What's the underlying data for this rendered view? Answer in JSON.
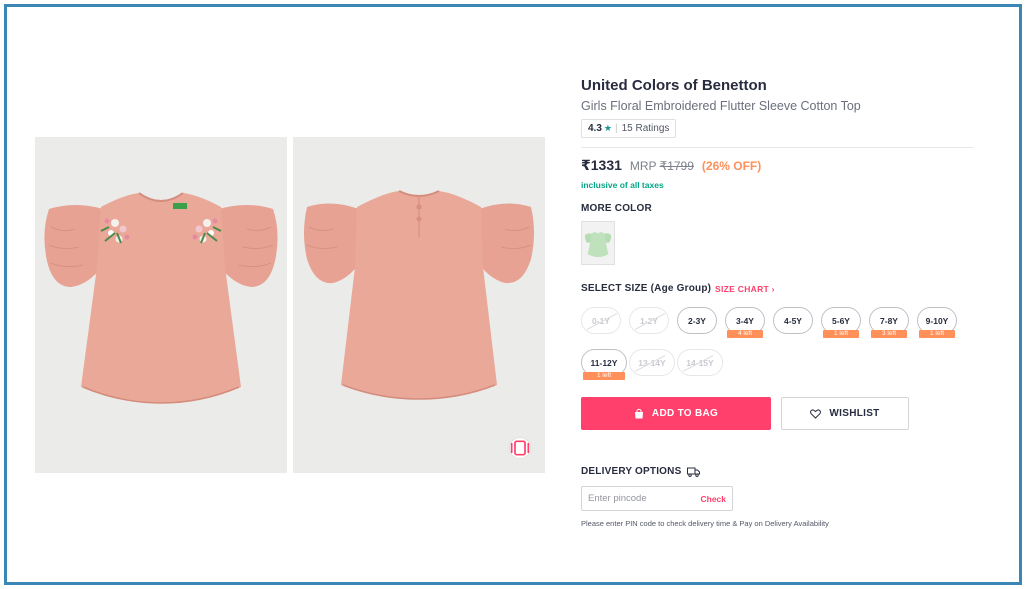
{
  "product": {
    "brand": "United Colors of Benetton",
    "name": "Girls Floral Embroidered Flutter Sleeve Cotton Top",
    "rating": "4.3",
    "rating_count": "15 Ratings",
    "price": "₹1331",
    "mrp_label": "MRP",
    "mrp": "₹1799",
    "discount": "(26% OFF)",
    "tax_note": "inclusive of all taxes"
  },
  "colors": {
    "title": "MORE COLOR",
    "options": [
      {
        "name": "mint green",
        "color": "#b6dcb4"
      }
    ]
  },
  "sizes": {
    "title": "SELECT SIZE (Age Group)",
    "chart_label": "SIZE CHART ›",
    "options": [
      {
        "label": "0-1Y",
        "available": false,
        "stock": ""
      },
      {
        "label": "1-2Y",
        "available": false,
        "stock": ""
      },
      {
        "label": "2-3Y",
        "available": true,
        "stock": ""
      },
      {
        "label": "3-4Y",
        "available": true,
        "stock": "4 left"
      },
      {
        "label": "4-5Y",
        "available": true,
        "stock": ""
      },
      {
        "label": "5-6Y",
        "available": true,
        "stock": "1 left"
      },
      {
        "label": "7-8Y",
        "available": true,
        "stock": "3 left"
      },
      {
        "label": "9-10Y",
        "available": true,
        "stock": "1 left"
      },
      {
        "label": "11-12Y",
        "available": true,
        "stock": "1 left"
      },
      {
        "label": "13-14Y",
        "available": false,
        "stock": ""
      },
      {
        "label": "14-15Y",
        "available": false,
        "stock": ""
      }
    ]
  },
  "actions": {
    "add_to_bag": "ADD TO BAG",
    "wishlist": "WISHLIST"
  },
  "delivery": {
    "title": "DELIVERY OPTIONS",
    "pincode_placeholder": "Enter pincode",
    "check_label": "Check",
    "note": "Please enter PIN code to check delivery time & Pay on Delivery Availability"
  },
  "theme": {
    "accent": "#ff3f6c",
    "discount": "#ff905a",
    "success": "#03a685",
    "frame_border": "#3a86b4",
    "product_color": "#e9a494"
  },
  "icons": {
    "rating": "star-icon",
    "similar": "similar-products-icon",
    "bag": "bag-icon",
    "wishlist": "heart-icon",
    "delivery": "truck-icon"
  }
}
